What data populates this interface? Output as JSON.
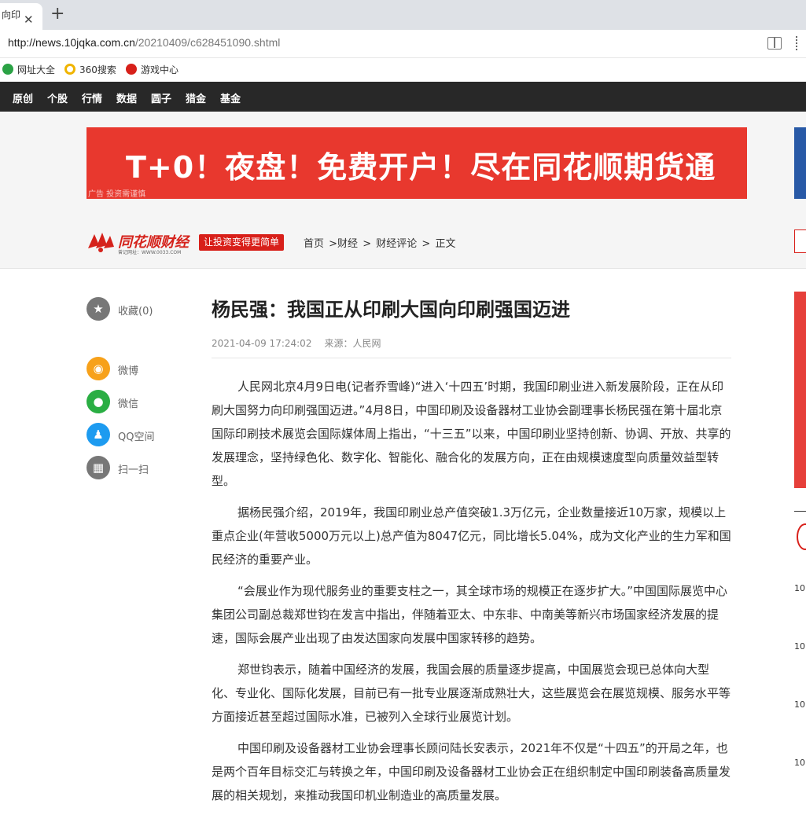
{
  "browser": {
    "tab_title": "向印",
    "url_host": "http://news.10jqka.com.cn",
    "url_path": "/20210409/c628451090.shtml"
  },
  "bookmarks": [
    {
      "label": "网址大全",
      "color": "#2ba245"
    },
    {
      "label": "360搜索",
      "color": "#f0b400"
    },
    {
      "label": "游戏中心",
      "color": "#d7201a"
    }
  ],
  "nav": [
    "原创",
    "个股",
    "行情",
    "数据",
    "圆子",
    "猎金",
    "基金"
  ],
  "ad": {
    "text": "T+0！夜盘！免费开户！尽在同花顺期货通",
    "note": "广告 投资需谨慎"
  },
  "brand": {
    "name": "同花顺财经",
    "sub": "曾记网址：WWW.0033.COM",
    "slogan": "让投资变得更简单"
  },
  "breadcrumb": [
    "首页",
    ">财经",
    ">",
    "财经评论",
    ">",
    "正文"
  ],
  "share": [
    {
      "label": "收藏(0)",
      "color": "#777777",
      "icon": "star-icon"
    },
    {
      "label": "微博",
      "color": "#f7a11a",
      "icon": "weibo-icon"
    },
    {
      "label": "微信",
      "color": "#2aae43",
      "icon": "wechat-icon"
    },
    {
      "label": "QQ空间",
      "color": "#1d9bf0",
      "icon": "qq-icon"
    },
    {
      "label": "扫一扫",
      "color": "#777777",
      "icon": "qrcode-icon"
    }
  ],
  "article": {
    "title": "杨民强：我国正从印刷大国向印刷强国迈进",
    "date": "2021-04-09 17:24:02",
    "source": "来源：人民网",
    "paragraphs": [
      "人民网北京4月9日电(记者乔雪峰)“进入‘十四五’时期，我国印刷业进入新发展阶段，正在从印刷大国努力向印刷强国迈进。”4月8日，中国印刷及设备器材工业协会副理事长杨民强在第十届北京国际印刷技术展览会国际媒体周上指出，“十三五”以来，中国印刷业坚持创新、协调、开放、共享的发展理念，坚持绿色化、数字化、智能化、融合化的发展方向，正在由规模速度型向质量效益型转型。",
      "据杨民强介绍，2019年，我国印刷业总产值突破1.3万亿元，企业数量接近10万家，规模以上重点企业(年营收5000万元以上)总产值为8047亿元，同比增长5.04%，成为文化产业的生力军和国民经济的重要产业。",
      "“会展业作为现代服务业的重要支柱之一，其全球市场的规模正在逐步扩大。”中国国际展览中心集团公司副总裁郑世钧在发言中指出，伴随着亚太、中东非、中南美等新兴市场国家经济发展的提速，国际会展产业出现了由发达国家向发展中国家转移的趋势。",
      "郑世钧表示，随着中国经济的发展，我国会展的质量逐步提高，中国展览会现已总体向大型化、专业化、国际化发展，目前已有一批专业展逐渐成熟壮大，这些展览会在展览规模、服务水平等方面接近甚至超过国际水准，已被列入全球行业展览计划。",
      "中国印刷及设备器材工业协会理事长顾问陆长安表示，2021年不仅是“十四五”的开局之年，也是两个百年目标交汇与转换之年，中国印刷及设备器材工业协会正在组织制定中国印刷装备高质量发展的相关规划，来推动我国印机业制造业的高质量发展。"
    ]
  },
  "right_times": [
    "10:",
    "10:",
    "10:",
    "10:"
  ]
}
